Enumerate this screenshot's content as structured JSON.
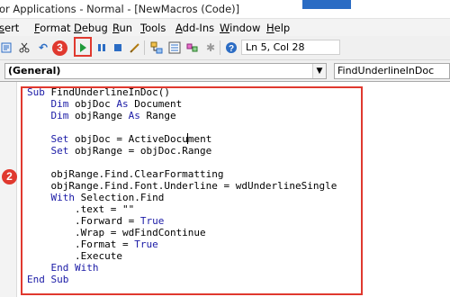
{
  "titlebar": {
    "title": "or Applications - Normal - [NewMacros (Code)]"
  },
  "menu": [
    "sert",
    "Format",
    "Debug",
    "Run",
    "Tools",
    "Add-Ins",
    "Window",
    "Help"
  ],
  "menu_underline_index": [
    0,
    0,
    0,
    0,
    0,
    0,
    0,
    0
  ],
  "toolbar": {
    "status": "Ln 5, Col 28",
    "icons": [
      "insert-module-icon",
      "cut-icon",
      "undo-icon",
      "redo-icon",
      "run-icon",
      "break-icon",
      "reset-icon",
      "design-mode-icon",
      "project-explorer-icon",
      "properties-icon",
      "object-browser-icon",
      "toolbox-icon",
      "help-icon"
    ]
  },
  "badges": {
    "run_step": "3",
    "code_step": "2"
  },
  "dropdowns": {
    "object": "(General)",
    "procedure": "FindUnderlineInDoc"
  },
  "code": [
    [
      {
        "k": "kw",
        "t": "Sub "
      },
      {
        "k": "tx",
        "t": "FindUnderlineInDoc()"
      }
    ],
    [
      {
        "k": "kw",
        "t": "    Dim "
      },
      {
        "k": "tx",
        "t": "objDoc "
      },
      {
        "k": "kw",
        "t": "As "
      },
      {
        "k": "tx",
        "t": "Document"
      }
    ],
    [
      {
        "k": "kw",
        "t": "    Dim "
      },
      {
        "k": "tx",
        "t": "objRange "
      },
      {
        "k": "kw",
        "t": "As "
      },
      {
        "k": "tx",
        "t": "Range"
      }
    ],
    [],
    [
      {
        "k": "kw",
        "t": "    Set "
      },
      {
        "k": "tx",
        "t": "objDoc = ActiveDocu"
      },
      {
        "k": "caret",
        "t": ""
      },
      {
        "k": "tx",
        "t": "ment"
      }
    ],
    [
      {
        "k": "kw",
        "t": "    Set "
      },
      {
        "k": "tx",
        "t": "objRange = objDoc.Range"
      }
    ],
    [],
    [
      {
        "k": "tx",
        "t": "    objRange.Find.ClearFormatting"
      }
    ],
    [
      {
        "k": "tx",
        "t": "    objRange.Find.Font.Underline = wdUnderlineSingle"
      }
    ],
    [
      {
        "k": "kw",
        "t": "    With "
      },
      {
        "k": "tx",
        "t": "Selection.Find"
      }
    ],
    [
      {
        "k": "tx",
        "t": "        .text = \"\""
      }
    ],
    [
      {
        "k": "tx",
        "t": "        .Forward = "
      },
      {
        "k": "kw",
        "t": "True"
      }
    ],
    [
      {
        "k": "tx",
        "t": "        .Wrap = wdFindContinue"
      }
    ],
    [
      {
        "k": "tx",
        "t": "        .Format = "
      },
      {
        "k": "kw",
        "t": "True"
      }
    ],
    [
      {
        "k": "tx",
        "t": "        .Execute"
      }
    ],
    [
      {
        "k": "kw",
        "t": "    End With"
      }
    ],
    [
      {
        "k": "kw",
        "t": "End Sub"
      }
    ]
  ]
}
